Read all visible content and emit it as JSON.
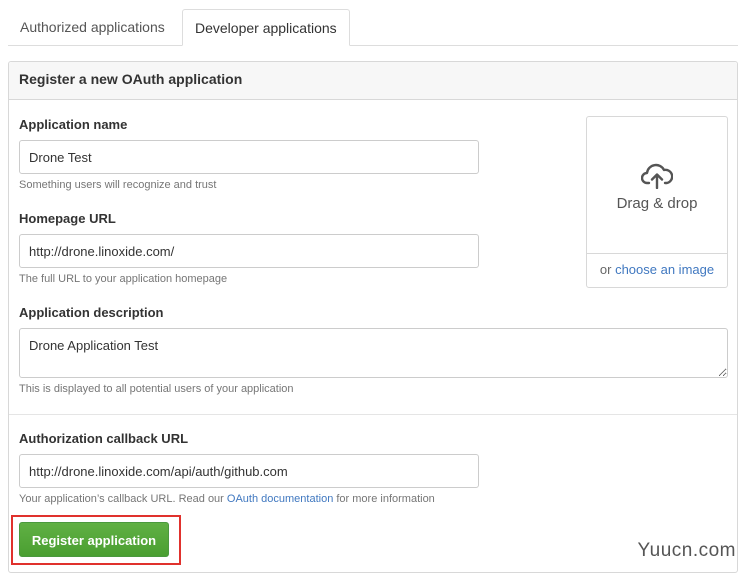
{
  "tabs": {
    "authorized": "Authorized applications",
    "developer": "Developer applications"
  },
  "panel": {
    "title": "Register a new OAuth application"
  },
  "form": {
    "app_name": {
      "label": "Application name",
      "value": "Drone Test",
      "note": "Something users will recognize and trust"
    },
    "homepage": {
      "label": "Homepage URL",
      "value": "http://drone.linoxide.com/",
      "note": "The full URL to your application homepage"
    },
    "description": {
      "label": "Application description",
      "value": "Drone Application Test",
      "note": "This is displayed to all potential users of your application"
    },
    "callback": {
      "label": "Authorization callback URL",
      "value": "http://drone.linoxide.com/api/auth/github.com",
      "note_before": "Your application’s callback URL. Read our",
      "note_link": "OAuth documentation",
      "note_after": "for more information"
    }
  },
  "upload": {
    "icon": "cloud-upload-icon",
    "drop_text": "Drag & drop",
    "or_text": "or",
    "choose_link": "choose an image"
  },
  "actions": {
    "register_label": "Register application"
  },
  "watermark": "Yuucn.com",
  "colors": {
    "button_green": "#55a532",
    "link_blue": "#4078c0",
    "highlight_red": "#e0312d"
  }
}
